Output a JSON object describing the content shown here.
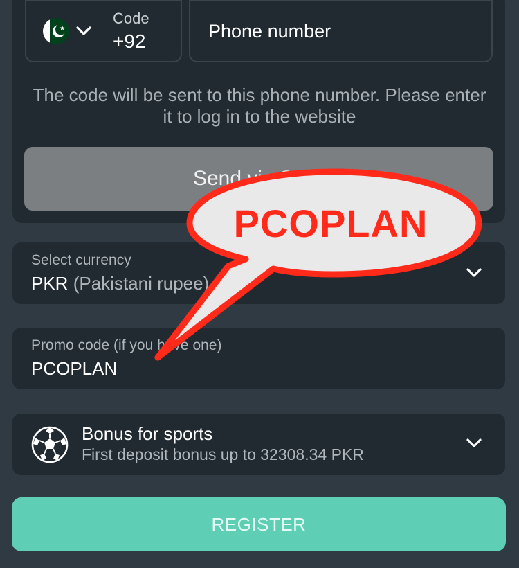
{
  "phone": {
    "code_label": "Code",
    "code_value": "+92",
    "phone_placeholder": "Phone number",
    "hint": "The code will be sent to this phone number. Please enter it to log in to the website",
    "send_sms_label": "Send via SMS"
  },
  "currency": {
    "label": "Select currency",
    "code": "PKR",
    "name": "(Pakistani rupee)"
  },
  "promo": {
    "label": "Promo code (if you have one)",
    "value": "PCOPLAN"
  },
  "bonus": {
    "title": "Bonus for sports",
    "subtitle": "First deposit bonus up to 32308.34 PKR"
  },
  "register_label": "REGISTER",
  "overlay": {
    "bubble_text": "PCOPLAN"
  },
  "colors": {
    "background": "#2f3a42",
    "panel": "#222a31",
    "register": "#5ecfb4",
    "sms_button": "#7c7f82",
    "callout_red": "#ff2a1a"
  },
  "icons": {
    "flag": "pakistan-flag-icon",
    "chevron": "chevron-down-icon",
    "ball": "soccer-ball-icon"
  }
}
